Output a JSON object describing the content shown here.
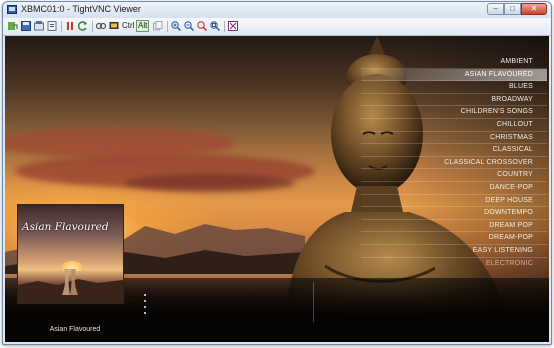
{
  "window": {
    "title": "XBMC01:0 - TightVNC Viewer",
    "buttons": {
      "minimize": "–",
      "maximize": "□",
      "close": "✕"
    }
  },
  "toolbar": {
    "ctrl_label": "Ctrl",
    "alt_label": "Alt"
  },
  "genres": {
    "selected": "ASIAN FLAVOURED",
    "items": [
      "AMBIENT",
      "ASIAN FLAVOURED",
      "BLUES",
      "BROADWAY",
      "CHILDREN'S SONGS",
      "CHILLOUT",
      "CHRISTMAS",
      "CLASSICAL",
      "CLASSICAL CROSSOVER",
      "COUNTRY",
      "DANCE-POP",
      "DEEP HOUSE",
      "DOWNTEMPO",
      "DREAM POP",
      "DREAM-POP",
      "EASY LISTENING",
      "ELECTRONIC"
    ]
  },
  "album": {
    "cover_title": "Asian Flavoured",
    "caption": "Asian Flavoured"
  },
  "colors": {
    "accent": "#e39a4a",
    "selection": "#ffffff"
  }
}
